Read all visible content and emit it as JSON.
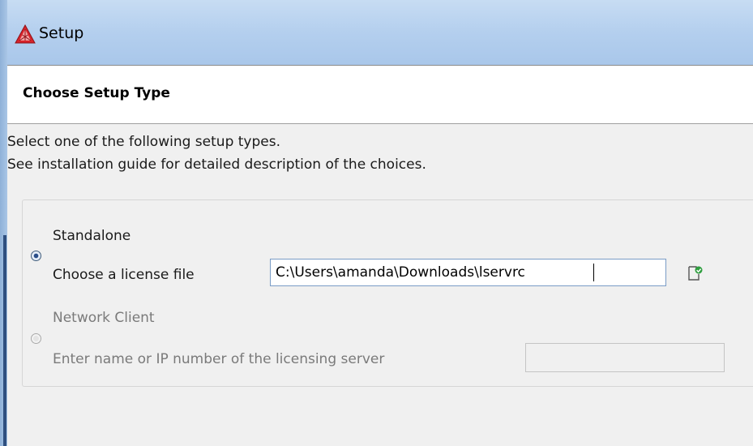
{
  "window": {
    "title": "Setup",
    "app_icon": "thermo-calc-triangle-icon"
  },
  "header": {
    "title": "Choose Setup Type"
  },
  "description": {
    "line1": "Select one of the following setup types.",
    "line2": "See installation guide for detailed description of the choices."
  },
  "options": {
    "standalone": {
      "heading": "Standalone",
      "label": "Choose a license file",
      "selected": true,
      "value": "C:\\Users\\amanda\\Downloads\\lservrc",
      "browse_icon": "open-file-icon"
    },
    "network": {
      "heading": "Network Client",
      "label": "Enter name or IP number of the licensing server",
      "selected": false,
      "value": ""
    }
  },
  "colors": {
    "titlebar": "#b4cfee",
    "dialog_bg": "#f0f0f0",
    "disabled_text": "#7a7a7a",
    "input_border_focus": "#7a9cc6"
  }
}
